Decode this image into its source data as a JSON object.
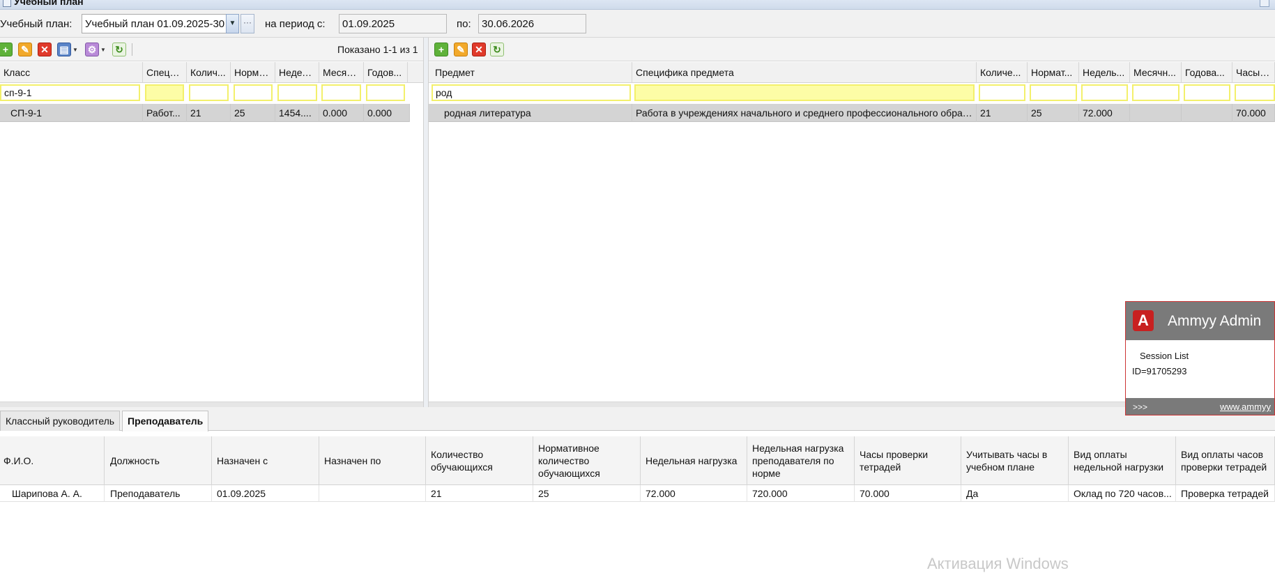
{
  "window": {
    "title": "Учебный план"
  },
  "plan_bar": {
    "plan_label": "Учебный план:",
    "plan_value": "Учебный план 01.09.2025-30",
    "period_from_label": "на период с:",
    "period_from_value": "01.09.2025",
    "period_to_label": "по:",
    "period_to_value": "30.06.2026",
    "ellipsis": "···"
  },
  "left_panel": {
    "shown_text": "Показано 1-1 из 1",
    "columns": [
      "Класс",
      "Специ...",
      "Колич...",
      "Норма...",
      "Недел...",
      "Месяч...",
      "Годов..."
    ],
    "filters": [
      "сп-9-1",
      "",
      "",
      "",
      "",
      "",
      ""
    ],
    "rows": [
      [
        "СП-9-1",
        "Работ...",
        "21",
        "25",
        "1454....",
        "0.000",
        "0.000"
      ]
    ]
  },
  "right_panel": {
    "columns": [
      "Предмет",
      "Специфика предмета",
      "Количе...",
      "Нормат...",
      "Недель...",
      "Месячн...",
      "Годова...",
      "Часы п..."
    ],
    "filters": [
      "род",
      "",
      "",
      "",
      "",
      "",
      "",
      ""
    ],
    "rows": [
      [
        "родная литература",
        "Работа в учреждениях начального и среднего профессионального образ...",
        "21",
        "25",
        "72.000",
        "",
        "",
        "70.000"
      ]
    ]
  },
  "tabs": [
    {
      "label": "Классный руководитель",
      "active": false
    },
    {
      "label": "Преподаватель",
      "active": true
    }
  ],
  "bottom_grid": {
    "columns": [
      "Ф.И.О.",
      "Должность",
      "Назначен с",
      "Назначен по",
      "Количество обучающихся",
      "Нормативное количество обучающихся",
      "Недельная нагрузка",
      "Недельная нагрузка преподавателя по норме",
      "Часы проверки тетрадей",
      "Учитывать часы в учебном плане",
      "Вид оплаты недельной нагрузки",
      "Вид оплаты часов проверки тетрадей"
    ],
    "rows": [
      [
        "Шарипова А. А.",
        "Преподаватель",
        "01.09.2025",
        "",
        "21",
        "25",
        "72.000",
        "720.000",
        "70.000",
        "Да",
        "Оклад по 720 часов...",
        "Проверка тетрадей"
      ]
    ]
  },
  "ammyy": {
    "title": "Ammyy Admin",
    "logo_letter": "A",
    "session_list": "Session List",
    "id_text": "ID=91705293",
    "arrows": ">>>",
    "url": "www.ammyy"
  },
  "watermark": "Активация Windows",
  "toolbar_icons": {
    "left": [
      "add-icon",
      "edit-icon",
      "delete-icon",
      "print-icon",
      "actions-icon",
      "refresh-icon"
    ],
    "right": [
      "add-icon",
      "edit-icon",
      "delete-icon",
      "refresh-icon"
    ]
  },
  "colors": {
    "filter_border": "#f3f06b",
    "filter_yellow": "#fdfda6",
    "selected_row": "#d4d4d4",
    "ammyy_red": "#c82020"
  }
}
